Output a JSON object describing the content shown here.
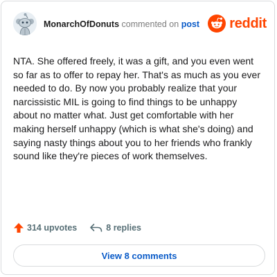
{
  "comment": {
    "author": "MonarchOfDonuts",
    "action_text": "commented on",
    "post_link": "post",
    "body": "NTA. She offered freely, it was a gift, and you even went so far as to offer to repay her. That's as much as you ever needed to do. By now you probably realize that your narcissistic MIL is going to find things to be unhappy about no matter what. Just get comfortable with her making herself unhappy (which is what she's doing) and saying nasty things about you to her friends who frankly sound like they're pieces of work themselves.",
    "upvotes": "314 upvotes",
    "replies": "8 replies"
  },
  "brand": {
    "wordmark": "reddit",
    "color": "#ff4500"
  },
  "footer": {
    "view_comments_label": "View 8 comments"
  },
  "icons": {
    "avatar": "snoo-avatar-icon",
    "logo": "reddit-logo-icon",
    "upvote": "upvote-arrow-icon",
    "reply": "reply-arrow-icon"
  },
  "colors": {
    "link": "#0a5bc8",
    "upvote": "#ff4500",
    "muted": "#576f76",
    "border": "#d9dbdd"
  }
}
